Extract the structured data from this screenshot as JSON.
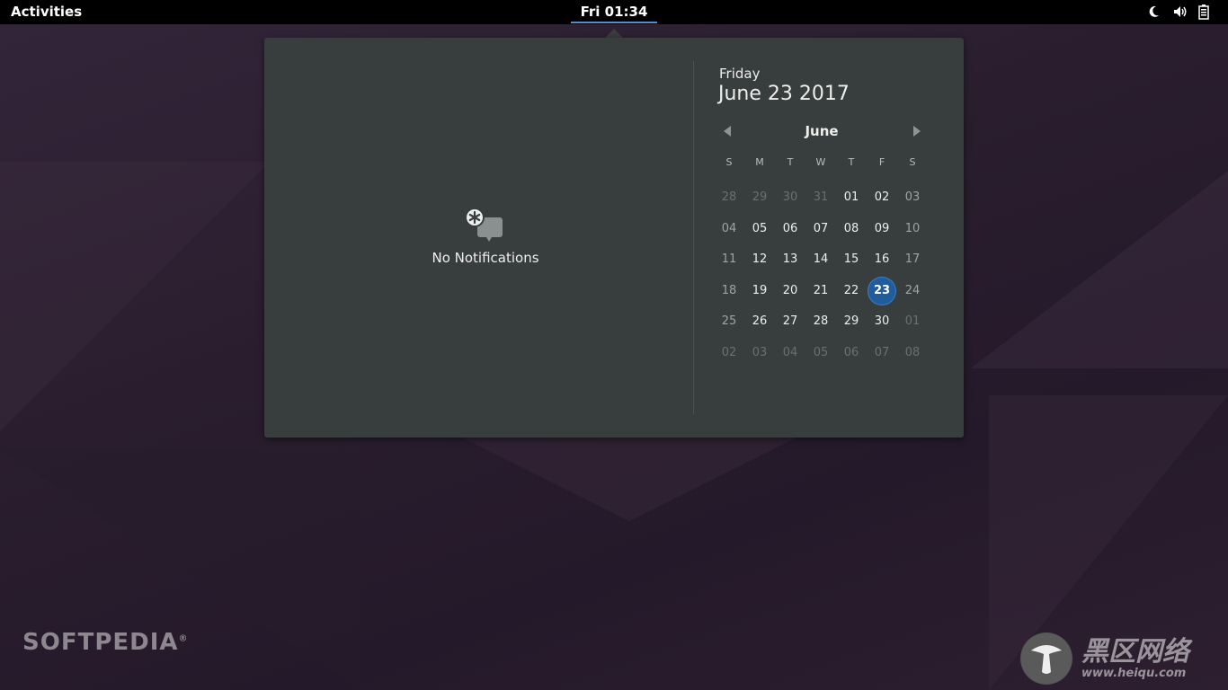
{
  "topbar": {
    "activities_label": "Activities",
    "clock": "Fri 01:34",
    "tray_icons": [
      "night-light-icon",
      "volume-icon",
      "battery-icon"
    ]
  },
  "notifications": {
    "empty_label": "No Notifications",
    "icon": "notifications-empty-icon"
  },
  "date_header": {
    "weekday": "Friday",
    "full_date": "June 23 2017"
  },
  "calendar": {
    "month": "June",
    "weekday_headers": [
      "S",
      "M",
      "T",
      "W",
      "T",
      "F",
      "S"
    ],
    "weeks": [
      [
        {
          "d": "28",
          "type": "other"
        },
        {
          "d": "29",
          "type": "other"
        },
        {
          "d": "30",
          "type": "other"
        },
        {
          "d": "31",
          "type": "other"
        },
        {
          "d": "01",
          "type": "day"
        },
        {
          "d": "02",
          "type": "day"
        },
        {
          "d": "03",
          "type": "weekend"
        }
      ],
      [
        {
          "d": "04",
          "type": "weekend"
        },
        {
          "d": "05",
          "type": "day"
        },
        {
          "d": "06",
          "type": "day"
        },
        {
          "d": "07",
          "type": "day"
        },
        {
          "d": "08",
          "type": "day"
        },
        {
          "d": "09",
          "type": "day"
        },
        {
          "d": "10",
          "type": "weekend"
        }
      ],
      [
        {
          "d": "11",
          "type": "weekend"
        },
        {
          "d": "12",
          "type": "day"
        },
        {
          "d": "13",
          "type": "day"
        },
        {
          "d": "14",
          "type": "day"
        },
        {
          "d": "15",
          "type": "day"
        },
        {
          "d": "16",
          "type": "day"
        },
        {
          "d": "17",
          "type": "weekend"
        }
      ],
      [
        {
          "d": "18",
          "type": "weekend"
        },
        {
          "d": "19",
          "type": "day"
        },
        {
          "d": "20",
          "type": "day"
        },
        {
          "d": "21",
          "type": "day"
        },
        {
          "d": "22",
          "type": "day"
        },
        {
          "d": "23",
          "type": "today"
        },
        {
          "d": "24",
          "type": "weekend"
        }
      ],
      [
        {
          "d": "25",
          "type": "weekend"
        },
        {
          "d": "26",
          "type": "day"
        },
        {
          "d": "27",
          "type": "day"
        },
        {
          "d": "28",
          "type": "day"
        },
        {
          "d": "29",
          "type": "day"
        },
        {
          "d": "30",
          "type": "day"
        },
        {
          "d": "01",
          "type": "other"
        }
      ],
      [
        {
          "d": "02",
          "type": "other"
        },
        {
          "d": "03",
          "type": "other"
        },
        {
          "d": "04",
          "type": "other"
        },
        {
          "d": "05",
          "type": "other"
        },
        {
          "d": "06",
          "type": "other"
        },
        {
          "d": "07",
          "type": "other"
        },
        {
          "d": "08",
          "type": "other"
        }
      ]
    ],
    "today_color": "#215d9c"
  },
  "watermarks": {
    "softpedia": "SOFTPEDIA",
    "softpedia_mark": "®",
    "heiqu_title": "黑区网络",
    "heiqu_url": "www.heiqu.com"
  }
}
